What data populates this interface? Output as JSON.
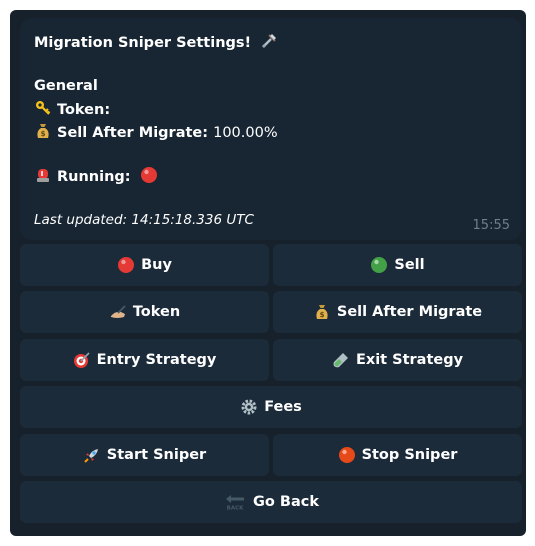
{
  "message": {
    "title": "Migration Sniper Settings!",
    "section": "General",
    "token_label": "Token:",
    "sell_after_label": "Sell After Migrate:",
    "sell_after_value": "100.00%",
    "running_label": "Running:",
    "last_updated": "Last updated: 14:15:18.336 UTC",
    "time": "15:55"
  },
  "buttons": {
    "buy": "Buy",
    "sell": "Sell",
    "token": "Token",
    "sell_after_migrate": "Sell After Migrate",
    "entry_strategy": "Entry Strategy",
    "exit_strategy": "Exit Strategy",
    "fees": "Fees",
    "start_sniper": "Start Sniper",
    "stop_sniper": "Stop Sniper",
    "go_back": "Go Back"
  },
  "icons": {
    "title": "tools-icon",
    "token": "key-icon",
    "sell_after": "money-bag-icon",
    "running": "siren-icon",
    "running_status": "red-circle-icon"
  },
  "colors": {
    "panel": "#17212b",
    "message_bubble": "#182533",
    "button": "#1c2b3a",
    "red_status": "#e53935",
    "green_status": "#43a047"
  }
}
